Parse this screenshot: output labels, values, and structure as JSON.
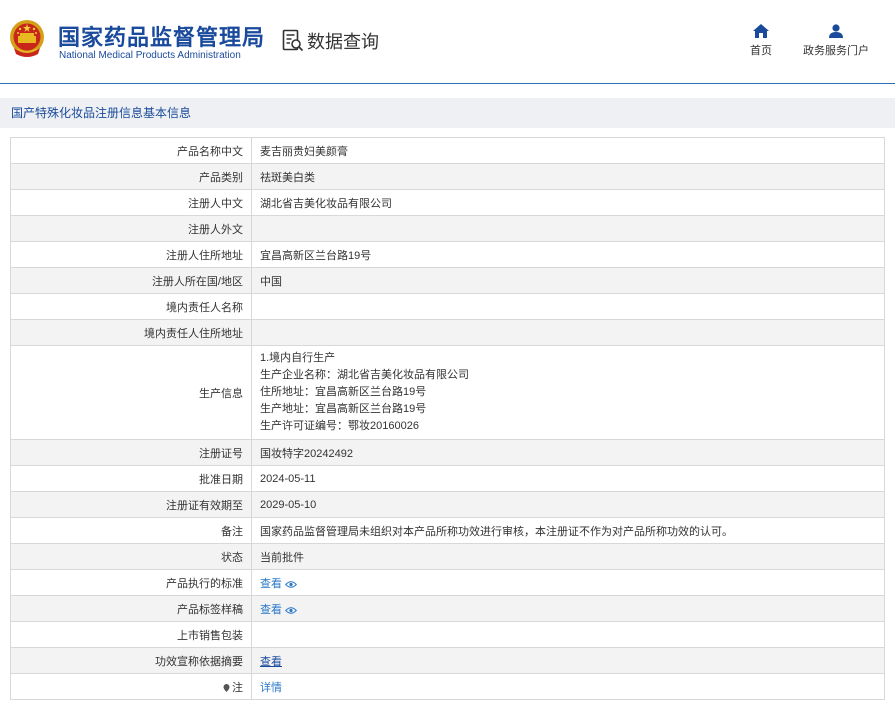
{
  "header": {
    "org_name_cn": "国家药品监督管理局",
    "org_name_en": "National Medical Products Administration",
    "query_title": "数据查询",
    "nav": [
      {
        "label": "首页",
        "icon": "home-icon"
      },
      {
        "label": "政务服务门户",
        "icon": "user-icon"
      }
    ]
  },
  "section": {
    "title": "国产特殊化妆品注册信息基本信息"
  },
  "colors": {
    "brand_blue": "#1a4a9c",
    "link_blue": "#2a78c8",
    "row_alt": "#f3f3f3",
    "section_bg": "#eef0f3"
  },
  "rows": [
    {
      "key": "产品名称中文",
      "value": "麦吉丽贵妇美颜膏"
    },
    {
      "key": "产品类别",
      "value": "祛斑美白类"
    },
    {
      "key": "注册人中文",
      "value": "湖北省吉美化妆品有限公司"
    },
    {
      "key": "注册人外文",
      "value": ""
    },
    {
      "key": "注册人住所地址",
      "value": "宜昌高新区兰台路19号"
    },
    {
      "key": "注册人所在国/地区",
      "value": "中国"
    },
    {
      "key": "境内责任人名称",
      "value": ""
    },
    {
      "key": "境内责任人住所地址",
      "value": ""
    },
    {
      "key": "生产信息",
      "lines": [
        "1.境内自行生产",
        "生产企业名称：湖北省吉美化妆品有限公司",
        "住所地址：宜昌高新区兰台路19号",
        "生产地址：宜昌高新区兰台路19号",
        "生产许可证编号：鄂妆20160026"
      ]
    },
    {
      "key": "注册证号",
      "value": "国妆特字20242492"
    },
    {
      "key": "批准日期",
      "value": "2024-05-11"
    },
    {
      "key": "注册证有效期至",
      "value": "2029-05-10"
    },
    {
      "key": "备注",
      "value": "国家药品监督管理局未组织对本产品所称功效进行审核，本注册证不作为对产品所称功效的认可。"
    },
    {
      "key": "状态",
      "value": "当前批件"
    },
    {
      "key": "产品执行的标准",
      "link": "查看"
    },
    {
      "key": "产品标签样稿",
      "link": "查看"
    },
    {
      "key": "上市销售包装",
      "value": ""
    },
    {
      "key": "功效宣称依据摘要",
      "link_underlined": "查看"
    },
    {
      "key": "注",
      "link": "详情"
    }
  ]
}
